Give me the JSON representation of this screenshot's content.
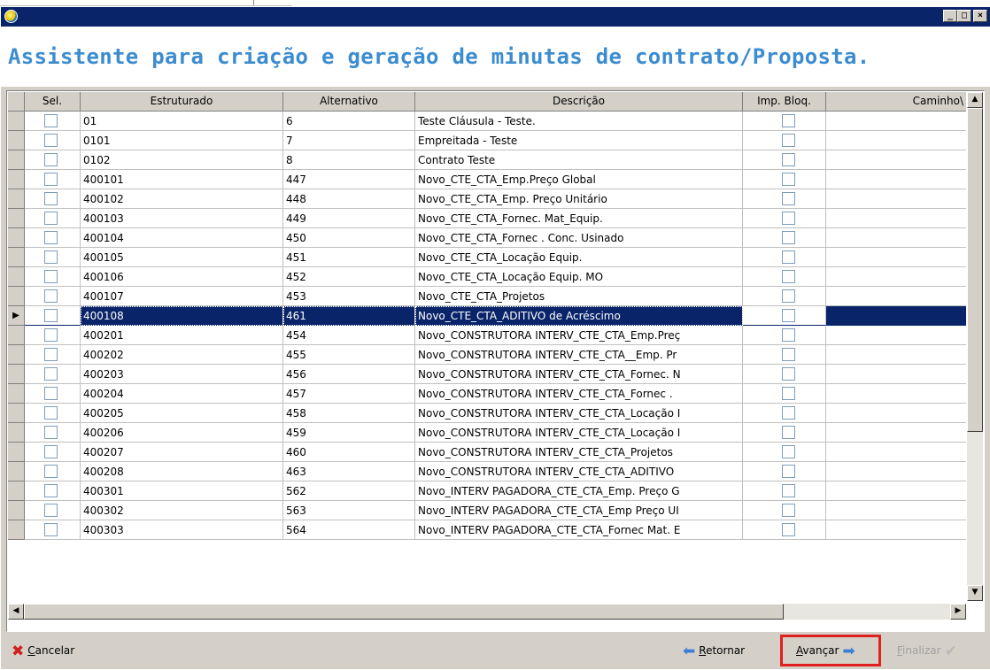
{
  "window": {
    "heading": "Assistente para criação e geração de minutas de contrato/Proposta.",
    "controls": {
      "minimize": "_",
      "maximize": "□",
      "close": "×"
    }
  },
  "grid": {
    "columns": [
      "Sel.",
      "Estruturado",
      "Alternativo",
      "Descrição",
      "Imp. Bloq.",
      "Caminho\\"
    ],
    "rows": [
      {
        "sel": false,
        "estruturado": "01",
        "alternativo": "6",
        "descricao": "Teste Cláusula - Teste.",
        "imp_bloq": false
      },
      {
        "sel": false,
        "estruturado": "0101",
        "alternativo": "7",
        "descricao": "Empreitada - Teste",
        "imp_bloq": false
      },
      {
        "sel": false,
        "estruturado": "0102",
        "alternativo": "8",
        "descricao": "Contrato Teste",
        "imp_bloq": false
      },
      {
        "sel": false,
        "estruturado": "400101",
        "alternativo": "447",
        "descricao": "Novo_CTE_CTA_Emp.Preço Global",
        "imp_bloq": false
      },
      {
        "sel": false,
        "estruturado": "400102",
        "alternativo": "448",
        "descricao": "Novo_CTE_CTA_Emp. Preço Unitário",
        "imp_bloq": false
      },
      {
        "sel": false,
        "estruturado": "400103",
        "alternativo": "449",
        "descricao": "Novo_CTE_CTA_Fornec. Mat_Equip.",
        "imp_bloq": false
      },
      {
        "sel": false,
        "estruturado": "400104",
        "alternativo": "450",
        "descricao": "Novo_CTE_CTA_Fornec . Conc. Usinado",
        "imp_bloq": false
      },
      {
        "sel": false,
        "estruturado": "400105",
        "alternativo": "451",
        "descricao": "Novo_CTE_CTA_Locação Equip.",
        "imp_bloq": false
      },
      {
        "sel": false,
        "estruturado": "400106",
        "alternativo": "452",
        "descricao": "Novo_CTE_CTA_Locação Equip. MO",
        "imp_bloq": false
      },
      {
        "sel": false,
        "estruturado": "400107",
        "alternativo": "453",
        "descricao": "Novo_CTE_CTA_Projetos",
        "imp_bloq": false
      },
      {
        "sel": true,
        "estruturado": "400108",
        "alternativo": "461",
        "descricao": "Novo_CTE_CTA_ADITIVO de Acréscimo",
        "imp_bloq": false
      },
      {
        "sel": false,
        "estruturado": "400201",
        "alternativo": "454",
        "descricao": "Novo_CONSTRUTORA INTERV_CTE_CTA_Emp.Preç",
        "imp_bloq": false
      },
      {
        "sel": false,
        "estruturado": "400202",
        "alternativo": "455",
        "descricao": "Novo_CONSTRUTORA INTERV_CTE_CTA__Emp. Pr",
        "imp_bloq": false
      },
      {
        "sel": false,
        "estruturado": "400203",
        "alternativo": "456",
        "descricao": "Novo_CONSTRUTORA INTERV_CTE_CTA_Fornec. N",
        "imp_bloq": false
      },
      {
        "sel": false,
        "estruturado": "400204",
        "alternativo": "457",
        "descricao": "Novo_CONSTRUTORA INTERV_CTE_CTA_Fornec .",
        "imp_bloq": false
      },
      {
        "sel": false,
        "estruturado": "400205",
        "alternativo": "458",
        "descricao": "Novo_CONSTRUTORA INTERV_CTE_CTA_Locação I",
        "imp_bloq": false
      },
      {
        "sel": false,
        "estruturado": "400206",
        "alternativo": "459",
        "descricao": "Novo_CONSTRUTORA INTERV_CTE_CTA_Locação I",
        "imp_bloq": false
      },
      {
        "sel": false,
        "estruturado": "400207",
        "alternativo": "460",
        "descricao": "Novo_CONSTRUTORA INTERV_CTE_CTA_Projetos",
        "imp_bloq": false
      },
      {
        "sel": false,
        "estruturado": "400208",
        "alternativo": "463",
        "descricao": "Novo_CONSTRUTORA INTERV_CTE_CTA_ADITIVO",
        "imp_bloq": false
      },
      {
        "sel": false,
        "estruturado": "400301",
        "alternativo": "562",
        "descricao": "Novo_INTERV PAGADORA_CTE_CTA_Emp. Preço G",
        "imp_bloq": false
      },
      {
        "sel": false,
        "estruturado": "400302",
        "alternativo": "563",
        "descricao": "Novo_INTERV PAGADORA_CTE_CTA_Emp Preço UI",
        "imp_bloq": false
      },
      {
        "sel": false,
        "estruturado": "400303",
        "alternativo": "564",
        "descricao": "Novo_INTERV PAGADORA_CTE_CTA_Fornec Mat. E",
        "imp_bloq": false
      }
    ],
    "selected_row_index": 10
  },
  "footer": {
    "cancel_label": "Cancelar",
    "back_label": "Retornar",
    "next_label": "Avançar",
    "finish_label": "Finalizar"
  },
  "colors": {
    "title_bar": "#0a246a",
    "heading_text": "#3c8cd0",
    "selection": "#0a246a",
    "highlight_box": "#e0201e"
  }
}
